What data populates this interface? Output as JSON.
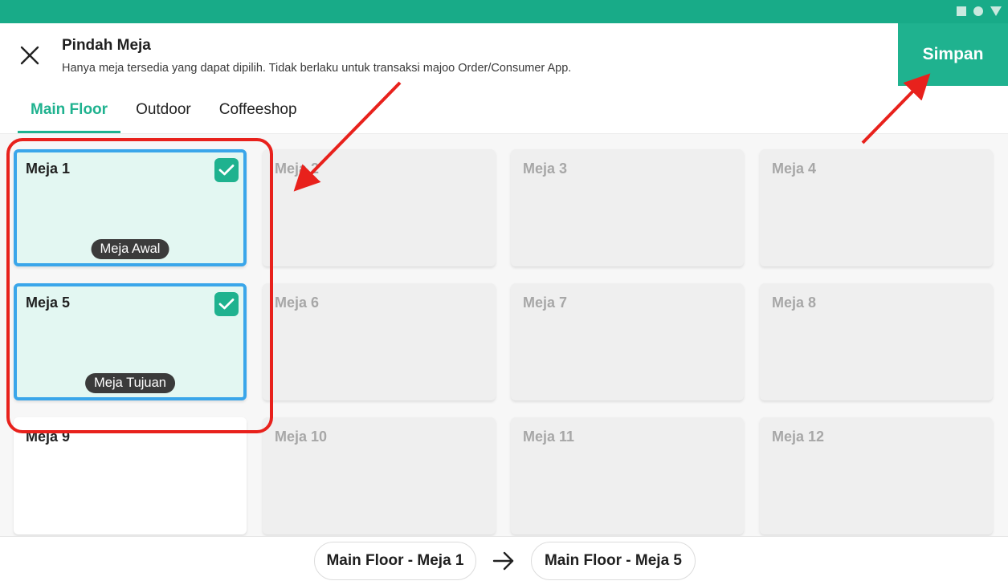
{
  "colors": {
    "accent": "#1fb28f",
    "status_bar": "#18ab88",
    "selected_border": "#3aa6ea",
    "annotation": "#e8211c"
  },
  "header": {
    "title": "Pindah Meja",
    "subtitle": "Hanya meja tersedia yang dapat dipilih. Tidak berlaku untuk transaksi majoo Order/Consumer App.",
    "save_label": "Simpan"
  },
  "tabs": [
    {
      "label": "Main Floor",
      "active": true
    },
    {
      "label": "Outdoor",
      "active": false
    },
    {
      "label": "Coffeeshop",
      "active": false
    }
  ],
  "tables": [
    {
      "name": "Meja 1",
      "state": "selected",
      "badge": "Meja Awal"
    },
    {
      "name": "Meja 2",
      "state": "disabled"
    },
    {
      "name": "Meja 3",
      "state": "disabled"
    },
    {
      "name": "Meja 4",
      "state": "disabled"
    },
    {
      "name": "Meja 5",
      "state": "selected",
      "badge": "Meja Tujuan"
    },
    {
      "name": "Meja 6",
      "state": "disabled"
    },
    {
      "name": "Meja 7",
      "state": "disabled"
    },
    {
      "name": "Meja 8",
      "state": "disabled"
    },
    {
      "name": "Meja 9",
      "state": "available"
    },
    {
      "name": "Meja 10",
      "state": "disabled"
    },
    {
      "name": "Meja 11",
      "state": "disabled"
    },
    {
      "name": "Meja 12",
      "state": "disabled"
    }
  ],
  "footer": {
    "from_label": "Main Floor - Meja 1",
    "to_label": "Main Floor - Meja 5",
    "arrow_icon": "arrow-right-icon"
  }
}
